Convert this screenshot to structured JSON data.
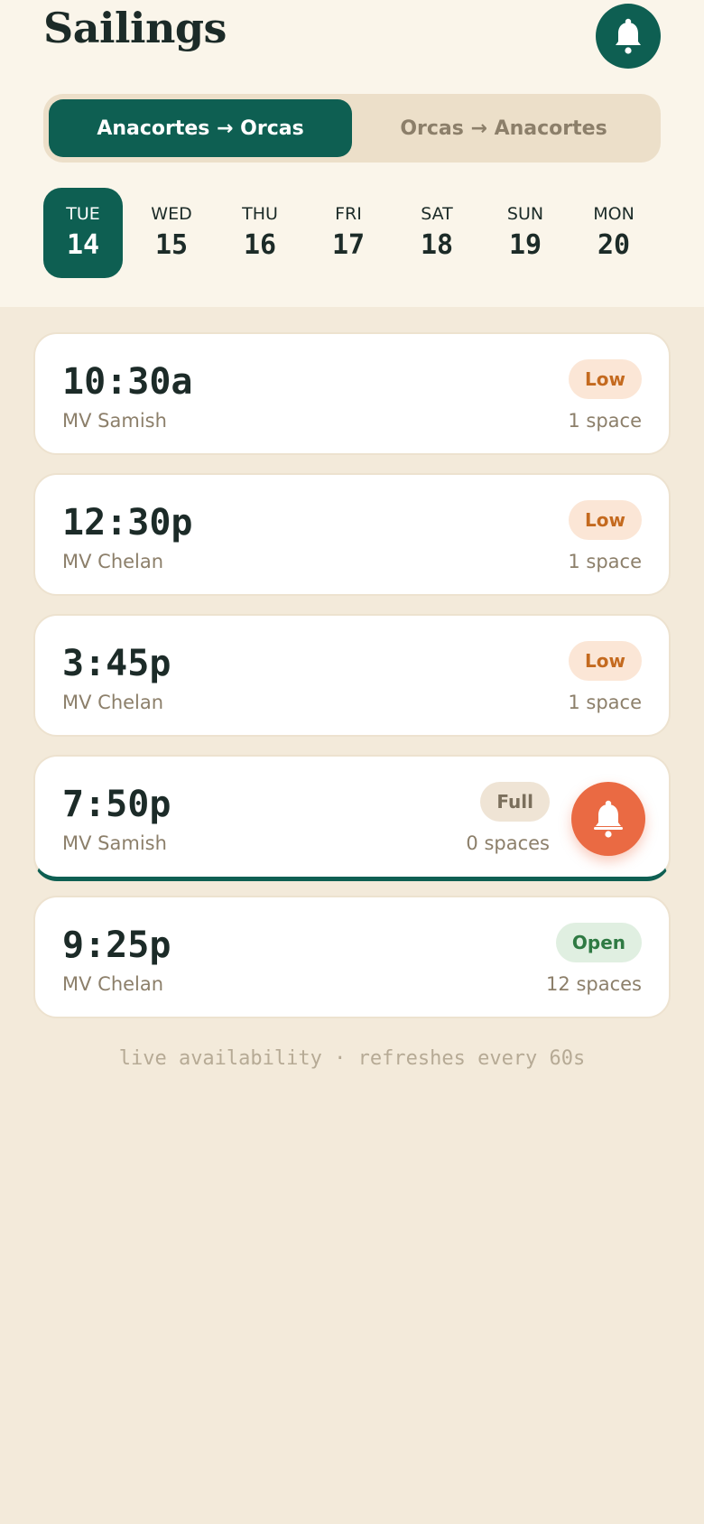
{
  "header": {
    "title": "Sailings",
    "bell_icon": "bell-icon"
  },
  "direction": {
    "options": [
      "Anacortes → Orcas",
      "Orcas → Anacortes"
    ],
    "selected": 0
  },
  "days": [
    {
      "dow": "TUE",
      "num": "14",
      "selected": true
    },
    {
      "dow": "WED",
      "num": "15"
    },
    {
      "dow": "THU",
      "num": "16"
    },
    {
      "dow": "FRI",
      "num": "17"
    },
    {
      "dow": "SAT",
      "num": "18"
    },
    {
      "dow": "SUN",
      "num": "19"
    },
    {
      "dow": "MON",
      "num": "20"
    }
  ],
  "sailings": [
    {
      "time": "10:30a",
      "vessel": "MV Samish",
      "status": "Low",
      "spaces": "1 space"
    },
    {
      "time": "12:30p",
      "vessel": "MV Chelan",
      "status": "Low",
      "spaces": "1 space"
    },
    {
      "time": "3:45p",
      "vessel": "MV Chelan",
      "status": "Low",
      "spaces": "1 space"
    },
    {
      "time": "7:50p",
      "vessel": "MV Samish",
      "status": "Full",
      "spaces": "0 spaces",
      "alert": true
    },
    {
      "time": "9:25p",
      "vessel": "MV Chelan",
      "status": "Open",
      "spaces": "12 spaces"
    }
  ],
  "footer": "live availability · refreshes every 60s",
  "colors": {
    "brand": "#0e5f52",
    "alert": "#ea6a43",
    "low": "#c46a1f",
    "open": "#2f7a43"
  }
}
